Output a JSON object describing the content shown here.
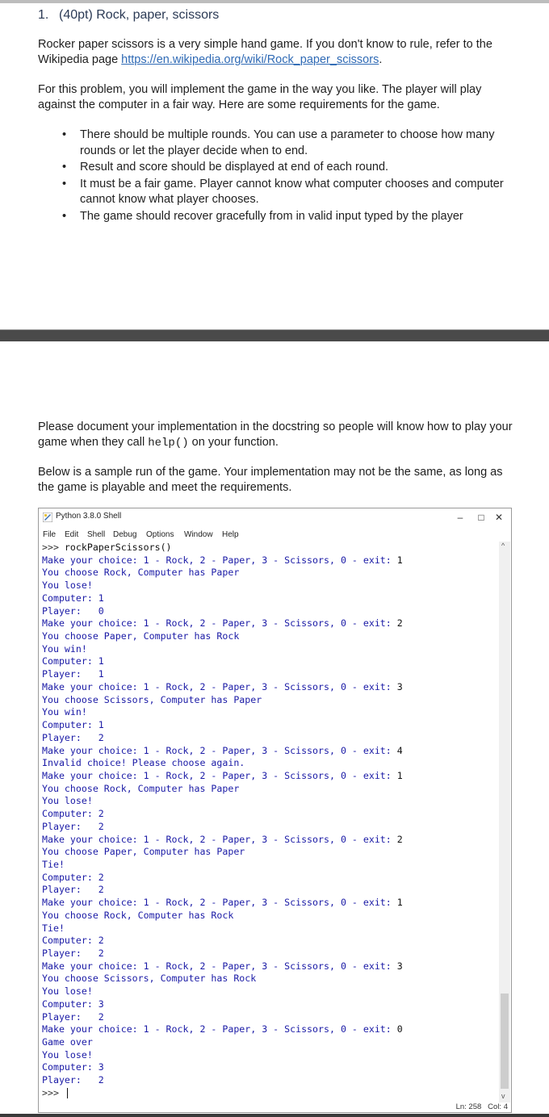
{
  "heading": {
    "number": "1.",
    "title": "(40pt) Rock, paper, scissors"
  },
  "intro": {
    "text_before_link": "Rocker paper scissors is a very simple hand game. If you don't know to rule, refer to the Wikipedia page ",
    "link": "https://en.wikipedia.org/wiki/Rock_paper_scissors",
    "text_after_link": "."
  },
  "para2": "For this problem, you will implement the game in the way you like. The player will play against the computer in a fair way. Here are some requirements for the game.",
  "requirements": [
    "There should be multiple rounds. You can use a parameter to choose how many rounds or let the player decide when to end.",
    "Result and score should be displayed at end of each round.",
    "It must be a fair game. Player cannot know what computer chooses and computer cannot know what player chooses.",
    "The game should recover gracefully from in valid input typed by the player"
  ],
  "bullet": "•",
  "docstring_para": {
    "before": "Please document your implementation in the docstring so people will know how to play your game when they call ",
    "code": "help()",
    "after": " on your function."
  },
  "sample_para": "Below is a sample run of the game. Your implementation may not be the same, as long as the game is playable and meet the requirements.",
  "idle": {
    "title": "Python 3.8.0 Shell",
    "minimize": "–",
    "maximize": "□",
    "close": "✕",
    "menu": [
      "File",
      "Edit",
      "Shell",
      "Debug",
      "Options",
      "Window",
      "Help"
    ],
    "status": "Ln: 258   Col: 4",
    "final_prompt": ">>> ",
    "lines": [
      {
        "k": "cmd",
        "p": ">>> ",
        "t": "rockPaperScissors()"
      },
      {
        "k": "in",
        "t": "Make your choice: 1 - Rock, 2 - Paper, 3 - Scissors, 0 - exit: ",
        "v": "1"
      },
      {
        "k": "out",
        "t": "You choose Rock, Computer has Paper"
      },
      {
        "k": "out",
        "t": "You lose!"
      },
      {
        "k": "out",
        "t": "Computer: 1"
      },
      {
        "k": "out",
        "t": "Player:   0"
      },
      {
        "k": "in",
        "t": "Make your choice: 1 - Rock, 2 - Paper, 3 - Scissors, 0 - exit: ",
        "v": "2"
      },
      {
        "k": "out",
        "t": "You choose Paper, Computer has Rock"
      },
      {
        "k": "out",
        "t": "You win!"
      },
      {
        "k": "out",
        "t": "Computer: 1"
      },
      {
        "k": "out",
        "t": "Player:   1"
      },
      {
        "k": "in",
        "t": "Make your choice: 1 - Rock, 2 - Paper, 3 - Scissors, 0 - exit: ",
        "v": "3"
      },
      {
        "k": "out",
        "t": "You choose Scissors, Computer has Paper"
      },
      {
        "k": "out",
        "t": "You win!"
      },
      {
        "k": "out",
        "t": "Computer: 1"
      },
      {
        "k": "out",
        "t": "Player:   2"
      },
      {
        "k": "in",
        "t": "Make your choice: 1 - Rock, 2 - Paper, 3 - Scissors, 0 - exit: ",
        "v": "4"
      },
      {
        "k": "out",
        "t": "Invalid choice! Please choose again."
      },
      {
        "k": "in",
        "t": "Make your choice: 1 - Rock, 2 - Paper, 3 - Scissors, 0 - exit: ",
        "v": "1"
      },
      {
        "k": "out",
        "t": "You choose Rock, Computer has Paper"
      },
      {
        "k": "out",
        "t": "You lose!"
      },
      {
        "k": "out",
        "t": "Computer: 2"
      },
      {
        "k": "out",
        "t": "Player:   2"
      },
      {
        "k": "in",
        "t": "Make your choice: 1 - Rock, 2 - Paper, 3 - Scissors, 0 - exit: ",
        "v": "2"
      },
      {
        "k": "out",
        "t": "You choose Paper, Computer has Paper"
      },
      {
        "k": "out",
        "t": "Tie!"
      },
      {
        "k": "out",
        "t": "Computer: 2"
      },
      {
        "k": "out",
        "t": "Player:   2"
      },
      {
        "k": "in",
        "t": "Make your choice: 1 - Rock, 2 - Paper, 3 - Scissors, 0 - exit: ",
        "v": "1"
      },
      {
        "k": "out",
        "t": "You choose Rock, Computer has Rock"
      },
      {
        "k": "out",
        "t": "Tie!"
      },
      {
        "k": "out",
        "t": "Computer: 2"
      },
      {
        "k": "out",
        "t": "Player:   2"
      },
      {
        "k": "in",
        "t": "Make your choice: 1 - Rock, 2 - Paper, 3 - Scissors, 0 - exit: ",
        "v": "3"
      },
      {
        "k": "out",
        "t": "You choose Scissors, Computer has Rock"
      },
      {
        "k": "out",
        "t": "You lose!"
      },
      {
        "k": "out",
        "t": "Computer: 3"
      },
      {
        "k": "out",
        "t": "Player:   2"
      },
      {
        "k": "in",
        "t": "Make your choice: 1 - Rock, 2 - Paper, 3 - Scissors, 0 - exit: ",
        "v": "0"
      },
      {
        "k": "out",
        "t": "Game over"
      },
      {
        "k": "out",
        "t": "You lose!"
      },
      {
        "k": "out",
        "t": "Computer: 3"
      },
      {
        "k": "out",
        "t": "Player:   2"
      }
    ]
  }
}
